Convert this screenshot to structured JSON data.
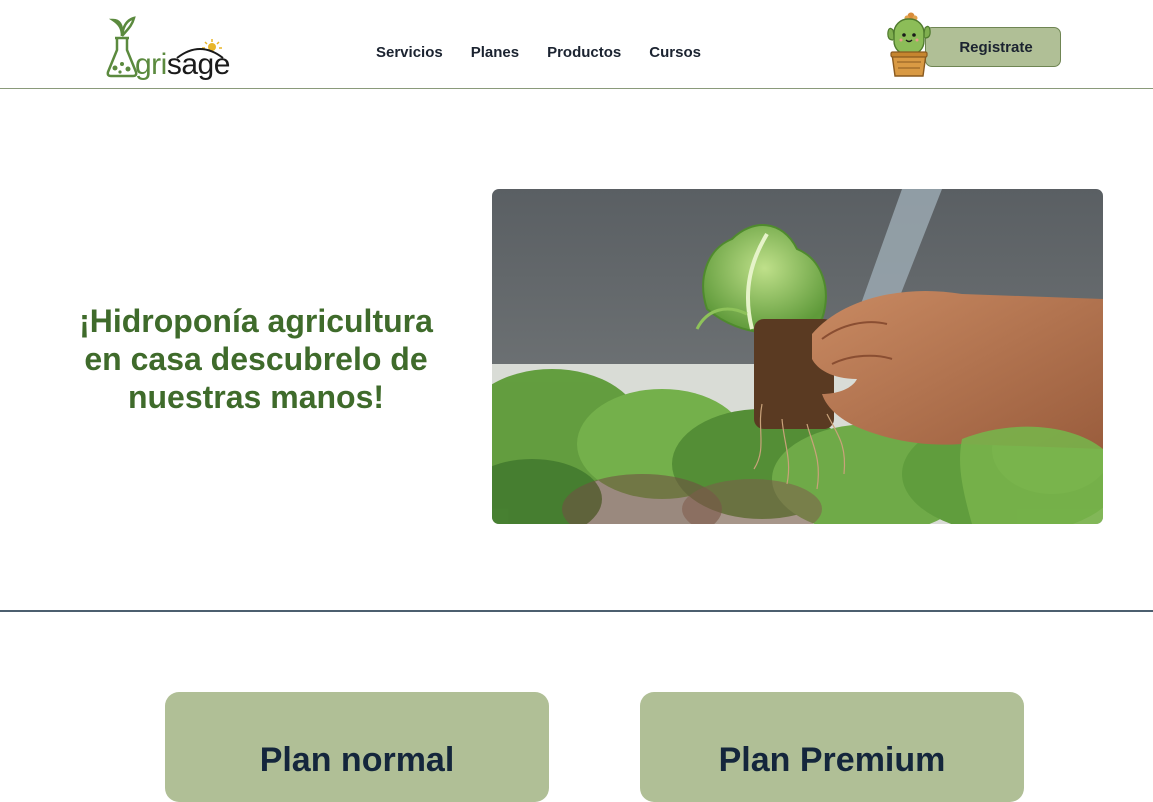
{
  "header": {
    "logo": {
      "text_green": "gri",
      "text_dark": "sage",
      "alt_letter": "A"
    },
    "nav": [
      {
        "label": "Servicios"
      },
      {
        "label": "Planes"
      },
      {
        "label": "Productos"
      },
      {
        "label": "Cursos"
      }
    ],
    "register_label": "Registrate"
  },
  "hero": {
    "title": "¡Hidroponía agricultura en casa descubrelo de nuestras manos!"
  },
  "plans": [
    {
      "title": "Plan normal"
    },
    {
      "title": "Plan Premium"
    }
  ],
  "colors": {
    "brand_green": "#3f6b2b",
    "button_green": "#b0bf96",
    "dark_text": "#1b2330"
  }
}
